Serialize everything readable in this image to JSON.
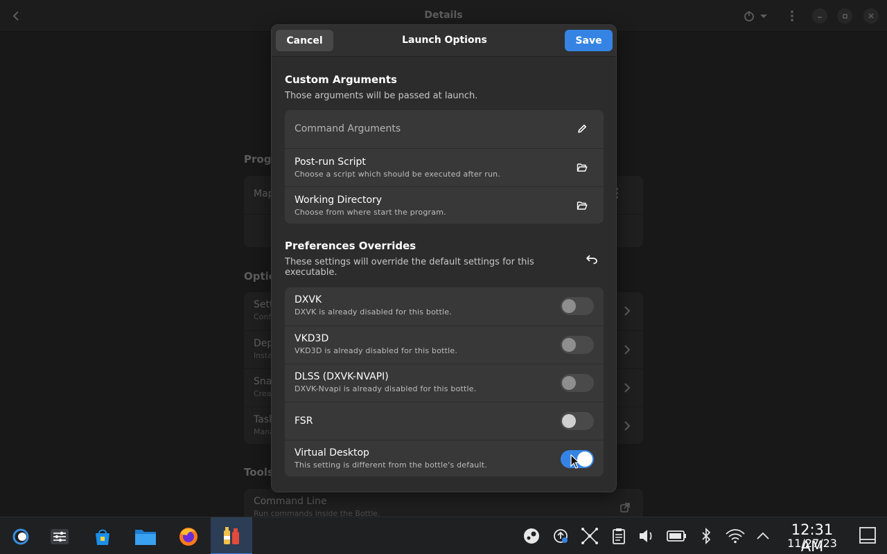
{
  "background": {
    "title": "Details",
    "sections": {
      "programs": "Prog",
      "options": "Optio",
      "tools": "Tools"
    },
    "program_row": "Map",
    "option_rows": [
      {
        "title": "Sett",
        "sub": "Conf"
      },
      {
        "title": "Dep",
        "sub": "Insta"
      },
      {
        "title": "Sna",
        "sub": "Crea"
      },
      {
        "title": "Task",
        "sub": "Mana"
      }
    ],
    "tools_row": {
      "title": "Command Line",
      "sub": "Run commands inside the Bottle."
    }
  },
  "dialog": {
    "title": "Launch Options",
    "cancel_label": "Cancel",
    "save_label": "Save",
    "custom_args": {
      "title": "Custom Arguments",
      "description": "Those arguments will be passed at launch.",
      "command_placeholder": "Command Arguments",
      "post_run": {
        "title": "Post-run Script",
        "sub": "Choose a script which should be executed after run."
      },
      "working_dir": {
        "title": "Working Directory",
        "sub": "Choose from where start the program."
      }
    },
    "overrides": {
      "title": "Preferences Overrides",
      "description": "These settings will override the default settings for this executable.",
      "items": [
        {
          "title": "DXVK",
          "sub": "DXVK is already disabled for this bottle.",
          "enabled": false
        },
        {
          "title": "VKD3D",
          "sub": "VKD3D is already disabled for this bottle.",
          "enabled": false
        },
        {
          "title": "DLSS (DXVK-NVAPI)",
          "sub": "DXVK-Nvapi is already disabled for this bottle.",
          "enabled": false
        },
        {
          "title": "FSR",
          "sub": "",
          "enabled": false
        },
        {
          "title": "Virtual Desktop",
          "sub": "This setting is different from the bottle's default.",
          "enabled": true
        }
      ]
    }
  },
  "taskbar": {
    "clock_time": "12:31 AM",
    "clock_date": "11/27/23"
  },
  "colors": {
    "accent": "#3584e4",
    "dialog_bg": "#2c2c2c",
    "card_bg": "#383838"
  }
}
